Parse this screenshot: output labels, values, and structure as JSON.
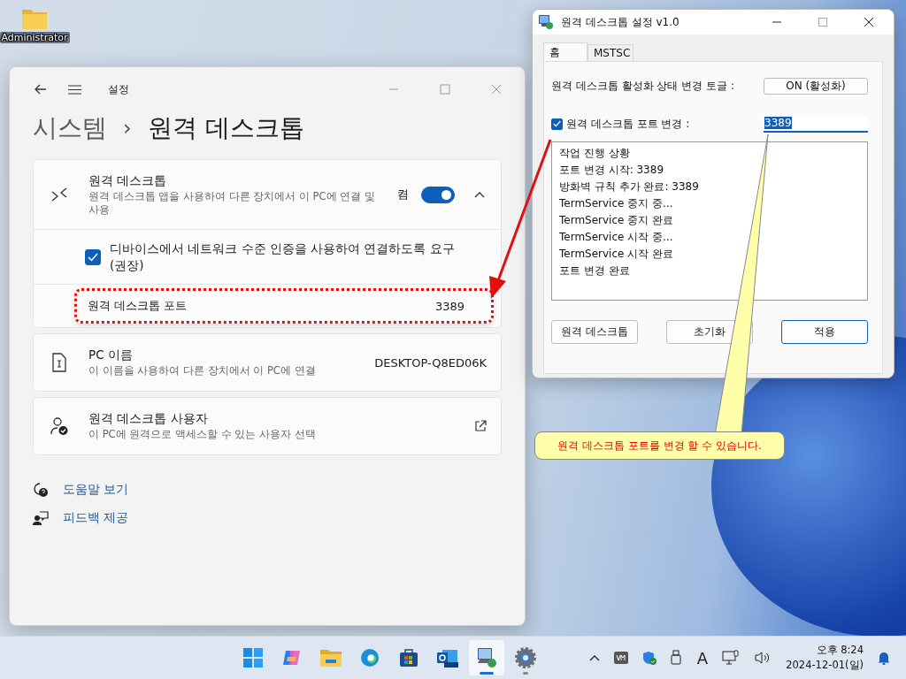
{
  "desktop": {
    "icons": [
      {
        "label": "Administrator"
      }
    ]
  },
  "settings_window": {
    "title": "설정",
    "breadcrumb": {
      "parent": "시스템",
      "separator": "›",
      "current": "원격 데스크톱"
    },
    "remote_desktop": {
      "title": "원격 데스크톱",
      "description": "원격 데스크톱 앱을 사용하여 다른 장치에서 이 PC에 연결 및 사용",
      "state_label": "켬",
      "on": true,
      "expanded": true,
      "nla": {
        "label": "디바이스에서 네트워크 수준 인증을 사용하여 연결하도록 요구 (권장)",
        "checked": true
      },
      "port": {
        "label": "원격 데스크톱 포트",
        "value": "3389",
        "highlighted": true
      }
    },
    "cards": [
      {
        "kind": "info",
        "title": "PC 이름",
        "description": "이 이름을 사용하여 다른 장치에서 이 PC에 연결",
        "value": "DESKTOP-Q8ED06K"
      },
      {
        "kind": "link",
        "title": "원격 데스크톱 사용자",
        "description": "이 PC에 원격으로 액세스할 수 있는 사용자 선택"
      }
    ],
    "links": [
      {
        "kind": "help",
        "label": "도움말 보기"
      },
      {
        "kind": "feedback",
        "label": "피드백 제공"
      }
    ]
  },
  "tool_window": {
    "title": "원격 데스크톱 설정 v1.0",
    "tabs": [
      {
        "label": "홈",
        "selected": true
      },
      {
        "label": "MSTSC",
        "selected": false
      }
    ],
    "toggle_label": "원격 데스크톱 활성화 상태 변경 토글 :",
    "toggle_button": "ON (활성화)",
    "port_change": {
      "label": "원격 데스크톱 포트 변경 :",
      "checked": true,
      "value": "3389"
    },
    "log": [
      "작업 진행 상황",
      "포트 변경 시작: 3389",
      "방화벽 규칙 추가 완료: 3389",
      "TermService 중지 중...",
      "TermService 중지 완료",
      "TermService 시작 중...",
      "TermService 시작 완료",
      "포트 변경 완료"
    ],
    "buttons": [
      {
        "label": "원격 데스크톱",
        "default": false
      },
      {
        "label": "초기화",
        "default": false
      },
      {
        "label": "적용",
        "default": true
      }
    ]
  },
  "callout": {
    "text": "원격 데스크톱 포트를 변경 할 수 있습니다."
  },
  "taskbar": {
    "apps": [
      {
        "kind": "start",
        "selected": false,
        "running": false
      },
      {
        "kind": "copilot",
        "selected": false,
        "running": false
      },
      {
        "kind": "folder",
        "selected": false,
        "running": false
      },
      {
        "kind": "edge",
        "selected": false,
        "running": false
      },
      {
        "kind": "store",
        "selected": false,
        "running": false
      },
      {
        "kind": "outlook",
        "selected": false,
        "running": false
      },
      {
        "kind": "remote",
        "selected": true,
        "running": true
      },
      {
        "kind": "settings",
        "selected": false,
        "running": true
      }
    ],
    "tray": {
      "ime": "A",
      "time": "오후 8:24",
      "date": "2024-12-01(일)"
    }
  }
}
